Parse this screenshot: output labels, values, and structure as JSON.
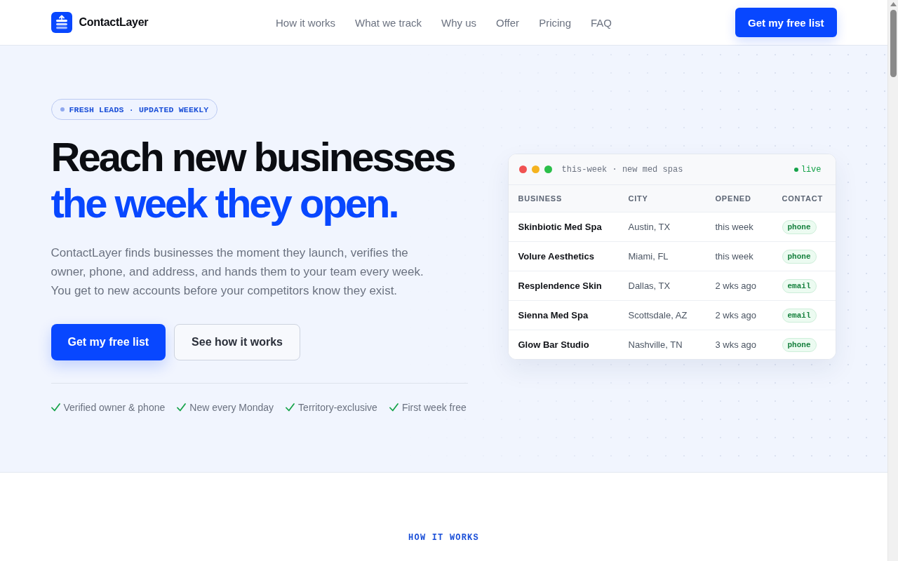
{
  "header": {
    "brand": "ContactLayer",
    "nav": [
      {
        "label": "How it works"
      },
      {
        "label": "What we track"
      },
      {
        "label": "Why us"
      },
      {
        "label": "Offer"
      },
      {
        "label": "Pricing"
      },
      {
        "label": "FAQ"
      }
    ],
    "cta": "Get my free list"
  },
  "hero": {
    "badge": "FRESH LEADS · UPDATED WEEKLY",
    "headline": "Reach new businesses",
    "headline_accent": "the week they open.",
    "description": "ContactLayer finds businesses the moment they launch, verifies the owner, phone, and address, and hands them to your team every week. You get to new accounts before your competitors know they exist.",
    "buttons": [
      {
        "kind": "primary",
        "label": "Get my free list"
      },
      {
        "kind": "secondary",
        "label": "See how it works"
      }
    ],
    "features": [
      "Verified owner & phone",
      "New every Monday",
      "Territory-exclusive",
      "First week free"
    ]
  },
  "preview": {
    "title": "this-week · new med spas",
    "status": "live",
    "columns": [
      "BUSINESS",
      "CITY",
      "OPENED",
      "CONTACT"
    ],
    "rows": [
      {
        "business": "Skinbiotic Med Spa",
        "city": "Austin, TX",
        "opened": "this week",
        "contact": "phone"
      },
      {
        "business": "Volure Aesthetics",
        "city": "Miami, FL",
        "opened": "this week",
        "contact": "phone"
      },
      {
        "business": "Resplendence Skin",
        "city": "Dallas, TX",
        "opened": "2 wks ago",
        "contact": "email"
      },
      {
        "business": "Sienna Med Spa",
        "city": "Scottsdale, AZ",
        "opened": "2 wks ago",
        "contact": "email"
      },
      {
        "business": "Glow Bar Studio",
        "city": "Nashville, TN",
        "opened": "3 wks ago",
        "contact": "phone"
      }
    ]
  },
  "next_section": {
    "eyebrow": "HOW IT WORKS"
  }
}
